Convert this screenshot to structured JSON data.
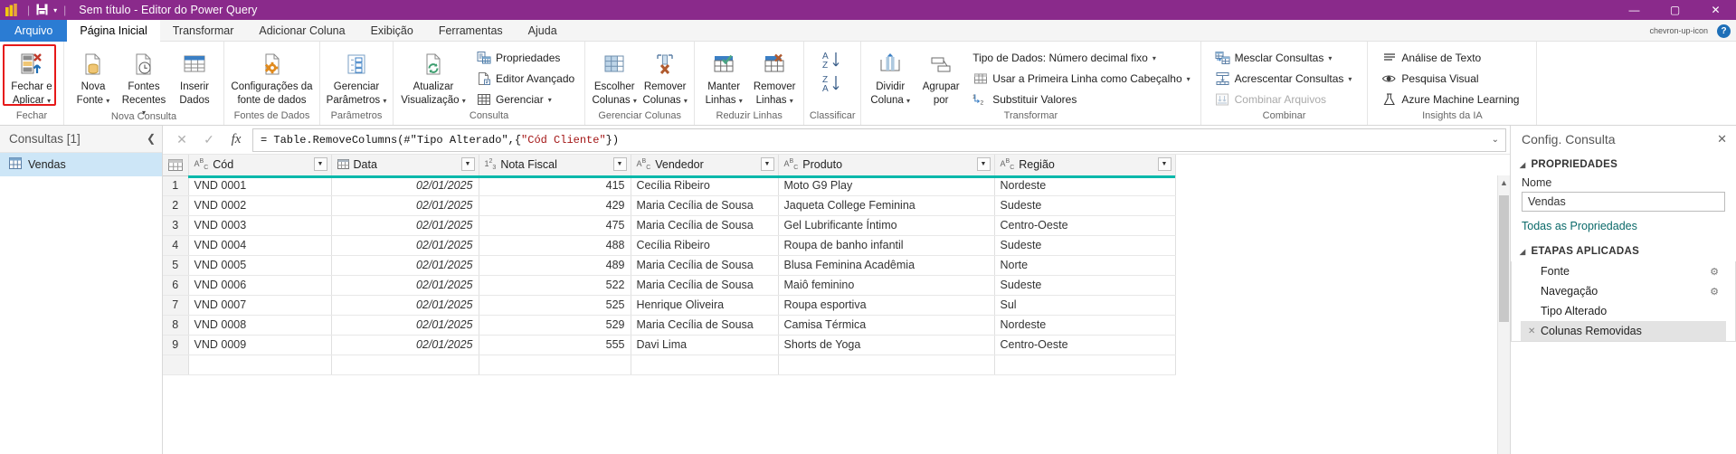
{
  "titlebar": {
    "app_icon": "power-bi-logo-icon",
    "save_icon": "save-icon",
    "qat_dropdown_icon": "chevron-down-icon",
    "title": "Sem título - Editor do Power Query",
    "minimize": "—",
    "maximize": "▢",
    "close": "✕"
  },
  "tabs": [
    {
      "label": "Arquivo",
      "type": "file"
    },
    {
      "label": "Página Inicial",
      "type": "active"
    },
    {
      "label": "Transformar",
      "type": "normal"
    },
    {
      "label": "Adicionar Coluna",
      "type": "normal"
    },
    {
      "label": "Exibição",
      "type": "normal"
    },
    {
      "label": "Ferramentas",
      "type": "normal"
    },
    {
      "label": "Ajuda",
      "type": "normal"
    }
  ],
  "tabs_right": {
    "collapse_icon": "chevron-up-icon",
    "help_label": "?"
  },
  "ribbon": {
    "groups": [
      {
        "name": "fechar",
        "label": "Fechar",
        "highlighted": true,
        "big_buttons": [
          {
            "line1": "Fechar e",
            "line2": "Aplicar",
            "caret": "▾",
            "icon": "close-and-apply-icon"
          }
        ]
      },
      {
        "name": "nova-consulta",
        "label": "Nova Consulta",
        "big_buttons": [
          {
            "line1": "Nova",
            "line2": "Fonte",
            "caret": "▾",
            "icon": "new-source-icon"
          },
          {
            "line1": "Fontes",
            "line2": "Recentes",
            "caret": "▾",
            "icon": "recent-sources-icon"
          },
          {
            "line1": "Inserir",
            "line2": "Dados",
            "caret": "",
            "icon": "enter-data-icon"
          }
        ]
      },
      {
        "name": "fontes-de-dados",
        "label": "Fontes de Dados",
        "big_buttons": [
          {
            "line1": "Configurações da",
            "line2": "fonte de dados",
            "caret": "",
            "icon": "data-source-settings-icon"
          }
        ]
      },
      {
        "name": "parametros",
        "label": "Parâmetros",
        "big_buttons": [
          {
            "line1": "Gerenciar",
            "line2": "Parâmetros",
            "caret": "▾",
            "icon": "manage-parameters-icon"
          }
        ]
      },
      {
        "name": "consulta",
        "label": "Consulta",
        "big_buttons": [
          {
            "line1": "Atualizar",
            "line2": "Visualização",
            "caret": "▾",
            "icon": "refresh-preview-icon"
          }
        ],
        "small_buttons": [
          {
            "label": "Propriedades",
            "icon": "properties-icon",
            "caret": "",
            "disabled": false
          },
          {
            "label": "Editor Avançado",
            "icon": "advanced-editor-icon",
            "caret": "",
            "disabled": false
          },
          {
            "label": "Gerenciar",
            "icon": "manage-table-icon",
            "caret": "▾",
            "disabled": false
          }
        ]
      },
      {
        "name": "gerenciar-colunas",
        "label": "Gerenciar Colunas",
        "big_buttons": [
          {
            "line1": "Escolher",
            "line2": "Colunas",
            "caret": "▾",
            "icon": "choose-columns-icon"
          },
          {
            "line1": "Remover",
            "line2": "Colunas",
            "caret": "▾",
            "icon": "remove-columns-icon"
          }
        ]
      },
      {
        "name": "reduzir-linhas",
        "label": "Reduzir Linhas",
        "big_buttons": [
          {
            "line1": "Manter",
            "line2": "Linhas",
            "caret": "▾",
            "icon": "keep-rows-icon"
          },
          {
            "line1": "Remover",
            "line2": "Linhas",
            "caret": "▾",
            "icon": "remove-rows-icon"
          }
        ]
      },
      {
        "name": "classificar",
        "label": "Classificar",
        "sort_buttons": [
          {
            "label": "A Z ↓",
            "icon": "sort-ascending-icon"
          },
          {
            "label": "Z A ↓",
            "icon": "sort-descending-icon"
          }
        ]
      },
      {
        "name": "transformar",
        "label": "Transformar",
        "big_buttons": [
          {
            "line1": "Dividir",
            "line2": "Coluna",
            "caret": "▾",
            "icon": "split-column-icon"
          },
          {
            "line1": "Agrupar",
            "line2": "por",
            "caret": "",
            "icon": "group-by-icon"
          }
        ],
        "small_buttons": [
          {
            "label": "Tipo de Dados: Número decimal fixo",
            "icon": "",
            "caret": "▾",
            "disabled": false
          },
          {
            "label": "Usar a Primeira Linha como Cabeçalho",
            "icon": "use-first-row-header-icon",
            "caret": "▾",
            "disabled": false
          },
          {
            "label": "Substituir Valores",
            "icon": "replace-values-icon",
            "caret": "",
            "disabled": false
          }
        ]
      },
      {
        "name": "combinar",
        "label": "Combinar",
        "small_buttons": [
          {
            "label": "Mesclar Consultas",
            "icon": "merge-queries-icon",
            "caret": "▾",
            "disabled": false
          },
          {
            "label": "Acrescentar Consultas",
            "icon": "append-queries-icon",
            "caret": "▾",
            "disabled": false
          },
          {
            "label": "Combinar Arquivos",
            "icon": "combine-files-icon",
            "caret": "",
            "disabled": true
          }
        ]
      },
      {
        "name": "insights-da-ia",
        "label": "Insights da IA",
        "small_buttons": [
          {
            "label": "Análise de Texto",
            "icon": "text-analytics-icon",
            "caret": "",
            "disabled": false
          },
          {
            "label": "Pesquisa Visual",
            "icon": "vision-icon",
            "caret": "",
            "disabled": false
          },
          {
            "label": "Azure Machine Learning",
            "icon": "azure-ml-icon",
            "caret": "",
            "disabled": false
          }
        ]
      }
    ]
  },
  "queries_pane": {
    "title": "Consultas [1]",
    "collapse_icon": "chevron-left-icon",
    "items": [
      {
        "label": "Vendas",
        "icon": "table-icon",
        "selected": true
      }
    ]
  },
  "formula_bar": {
    "cancel_icon": "cancel-x-icon",
    "accept_icon": "accept-check-icon",
    "fx_icon": "fx-icon",
    "formula_prefix": "= Table.RemoveColumns(#\"Tipo Alterado\",{",
    "formula_string": "\"Cód Cliente\"",
    "formula_suffix": "})",
    "expand_icon": "chevron-down-icon"
  },
  "grid": {
    "columns": [
      {
        "name": "Cód",
        "type_icon": "ABC"
      },
      {
        "name": "Data",
        "type_icon": "calendar"
      },
      {
        "name": "Nota Fiscal",
        "type_icon": "123"
      },
      {
        "name": "Vendedor",
        "type_icon": "ABC"
      },
      {
        "name": "Produto",
        "type_icon": "ABC"
      },
      {
        "name": "Região",
        "type_icon": "ABC"
      }
    ],
    "filter_icon": "filter-dropdown-icon",
    "rows": [
      {
        "n": "1",
        "cod": "VND 0001",
        "data": "02/01/2025",
        "nota": "415",
        "vendedor": "Cecília Ribeiro",
        "produto": "Moto G9 Play",
        "regiao": "Nordeste"
      },
      {
        "n": "2",
        "cod": "VND 0002",
        "data": "02/01/2025",
        "nota": "429",
        "vendedor": "Maria Cecília de Sousa",
        "produto": "Jaqueta College Feminina",
        "regiao": "Sudeste"
      },
      {
        "n": "3",
        "cod": "VND 0003",
        "data": "02/01/2025",
        "nota": "475",
        "vendedor": "Maria Cecília de Sousa",
        "produto": "Gel Lubrificante Íntimo",
        "regiao": "Centro-Oeste"
      },
      {
        "n": "4",
        "cod": "VND 0004",
        "data": "02/01/2025",
        "nota": "488",
        "vendedor": "Cecília Ribeiro",
        "produto": "Roupa de banho infantil",
        "regiao": "Sudeste"
      },
      {
        "n": "5",
        "cod": "VND 0005",
        "data": "02/01/2025",
        "nota": "489",
        "vendedor": "Maria Cecília de Sousa",
        "produto": "Blusa Feminina Acadêmia",
        "regiao": "Norte"
      },
      {
        "n": "6",
        "cod": "VND 0006",
        "data": "02/01/2025",
        "nota": "522",
        "vendedor": "Maria Cecília de Sousa",
        "produto": "Maiô feminino",
        "regiao": "Sudeste"
      },
      {
        "n": "7",
        "cod": "VND 0007",
        "data": "02/01/2025",
        "nota": "525",
        "vendedor": "Henrique Oliveira",
        "produto": "Roupa esportiva",
        "regiao": "Sul"
      },
      {
        "n": "8",
        "cod": "VND 0008",
        "data": "02/01/2025",
        "nota": "529",
        "vendedor": "Maria Cecília de Sousa",
        "produto": "Camisa Térmica",
        "regiao": "Nordeste"
      },
      {
        "n": "9",
        "cod": "VND 0009",
        "data": "02/01/2025",
        "nota": "555",
        "vendedor": "Davi Lima",
        "produto": "Shorts de Yoga",
        "regiao": "Centro-Oeste"
      }
    ]
  },
  "settings_pane": {
    "title": "Config. Consulta",
    "close_icon": "close-icon",
    "properties_section": "PROPRIEDADES",
    "name_label": "Nome",
    "name_value": "Vendas",
    "all_properties_link": "Todas as Propriedades",
    "steps_section": "ETAPAS APLICADAS",
    "steps": [
      {
        "label": "Fonte",
        "gear": true,
        "selected": false,
        "deletable": false
      },
      {
        "label": "Navegação",
        "gear": true,
        "selected": false,
        "deletable": false
      },
      {
        "label": "Tipo Alterado",
        "gear": false,
        "selected": false,
        "deletable": false
      },
      {
        "label": "Colunas Removidas",
        "gear": false,
        "selected": true,
        "deletable": true
      }
    ]
  },
  "colors": {
    "title_bar": "#8A2A8B",
    "file_tab": "#2b7cd3",
    "selection_green": "#01b8aa",
    "highlight_red": "#e61919",
    "selected_query": "#cde6f7"
  }
}
